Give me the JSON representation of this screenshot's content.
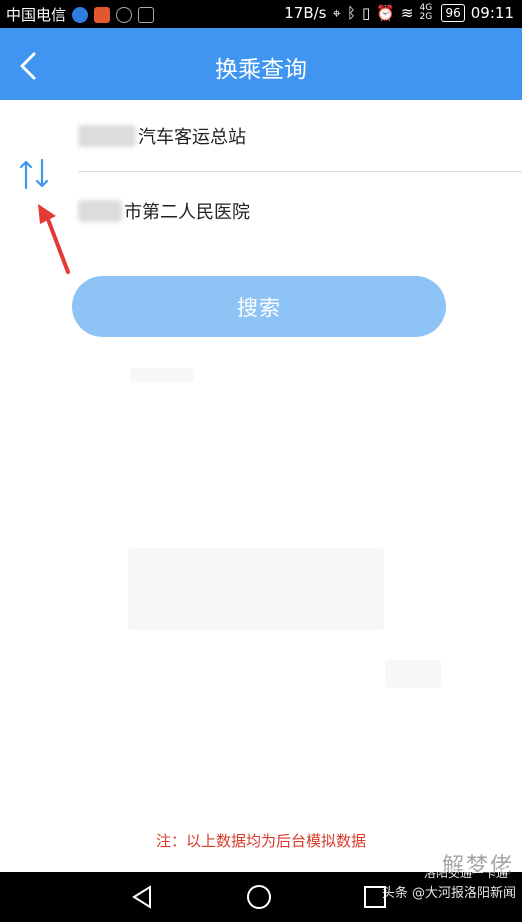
{
  "status_bar": {
    "carrier": "中国电信",
    "speed": "17B/s",
    "battery": "96",
    "time": "09:11",
    "network": "4G 2G"
  },
  "header": {
    "title": "换乘查询",
    "back_icon": "chevron-left-icon"
  },
  "form": {
    "start_value": "汽车客运总站",
    "end_value": "第二人民医院",
    "end_prefix_partial": "市",
    "swap_icon": "swap-vertical-icon"
  },
  "search_button": {
    "label": "搜索"
  },
  "note": {
    "text": "注：以上数据均为后台模拟数据"
  },
  "watermark": {
    "text": "头条 @大河报洛阳新闻",
    "overlay_text": "洛阳交通一卡通",
    "logo_text": "解梦佬"
  },
  "colors": {
    "app_bar": "#3f95f0",
    "search_button": "#8ec3f6",
    "note": "#d93a2b",
    "annotation_arrow": "#e53935"
  }
}
